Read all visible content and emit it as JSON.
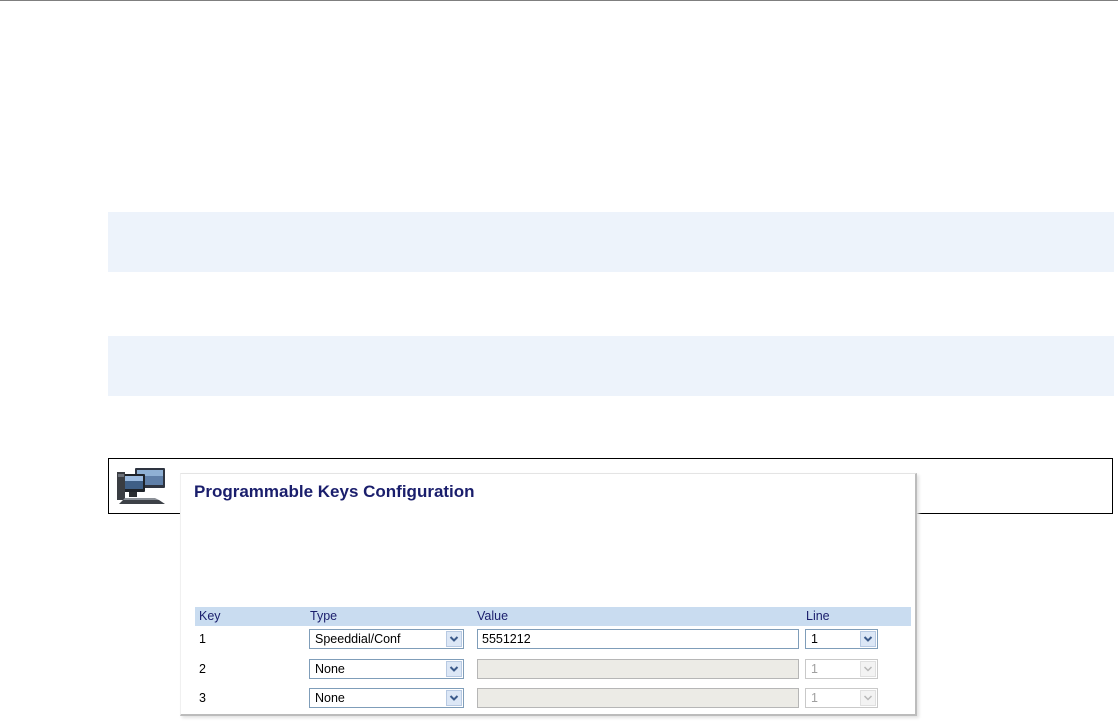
{
  "panel": {
    "title": "Programmable Keys Configuration"
  },
  "table": {
    "headers": {
      "key": "Key",
      "type": "Type",
      "value": "Value",
      "line": "Line"
    },
    "rows": [
      {
        "key": "1",
        "type": "Speeddial/Conf",
        "value": "5551212",
        "line": "1",
        "enabled": true
      },
      {
        "key": "2",
        "type": "None",
        "value": "",
        "line": "1",
        "enabled": false
      },
      {
        "key": "3",
        "type": "None",
        "value": "",
        "line": "1",
        "enabled": false
      }
    ]
  },
  "icons": {
    "note": "computer-monitor-icon",
    "dropdown": "chevron-down-icon"
  },
  "colors": {
    "title": "#1a1e6c",
    "header_bg": "#c9dcf0",
    "band_bg": "#edf3fb",
    "disabled_input_bg": "#ecebe6"
  }
}
